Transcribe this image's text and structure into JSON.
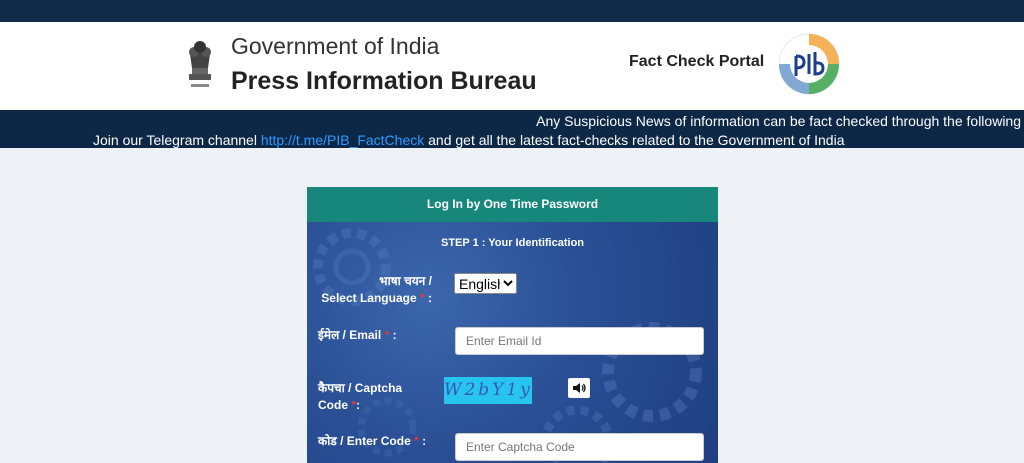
{
  "header": {
    "gov_line": "Government of India",
    "bureau_line": "Press Information Bureau",
    "portal_title": "Fact Check Portal"
  },
  "ticker": {
    "line1": "Any Suspicious News of information can be fact checked through the following",
    "line2_prefix": "Join our Telegram channel ",
    "telegram_link": "http://t.me/PIB_FactCheck",
    "line2_suffix": " and get all the latest fact-checks related to the Government of India"
  },
  "login": {
    "header": "Log In by One Time Password",
    "step_title": "STEP 1 : Your Identification",
    "language_label_hi": "भाषा चयन /",
    "language_label_en": "Select Language",
    "language_selected": "English",
    "email_label": "ईमेल / Email",
    "email_placeholder": "Enter Email Id",
    "captcha_label_line1": "कैपचा / Captcha",
    "captcha_label_line2": "Code",
    "captcha_text": "W2bY1y",
    "code_label": "कोड / Enter Code",
    "code_placeholder": "Enter Captcha Code",
    "required_mark": "*",
    "colon": ":"
  },
  "colors": {
    "navy": "#0d2746",
    "teal": "#17877b",
    "link": "#2d9cff",
    "required": "#e03a3a"
  }
}
